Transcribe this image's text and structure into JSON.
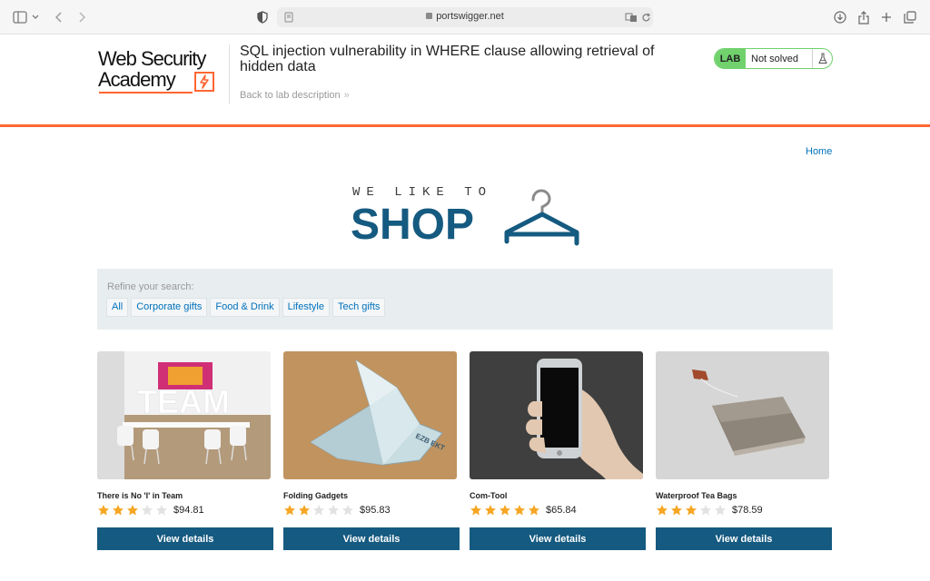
{
  "browser": {
    "url": "portswigger.net"
  },
  "lab_header": {
    "logo_line1": "Web Security",
    "logo_line2": "Academy",
    "title": "SQL injection vulnerability in WHERE clause allowing retrieval of hidden data",
    "back_link": "Back to lab description",
    "badge_label": "LAB",
    "badge_status": "Not solved",
    "accent_color": "#ff6633",
    "solved_color": "#70d16d"
  },
  "shop": {
    "home_link": "Home",
    "logo_top": "WE LIKE TO",
    "logo_main": "SHOP",
    "brand_color": "#155a80"
  },
  "refine": {
    "label": "Refine your search:",
    "filters": [
      "All",
      "Corporate gifts",
      "Food & Drink",
      "Lifestyle",
      "Tech gifts"
    ]
  },
  "products": [
    {
      "name": "There is No 'I' in Team",
      "rating": 3,
      "price": "$94.81",
      "button": "View details"
    },
    {
      "name": "Folding Gadgets",
      "rating": 2,
      "price": "$95.83",
      "button": "View details"
    },
    {
      "name": "Com-Tool",
      "rating": 5,
      "price": "$65.84",
      "button": "View details"
    },
    {
      "name": "Waterproof Tea Bags",
      "rating": 3,
      "price": "$78.59",
      "button": "View details"
    }
  ]
}
